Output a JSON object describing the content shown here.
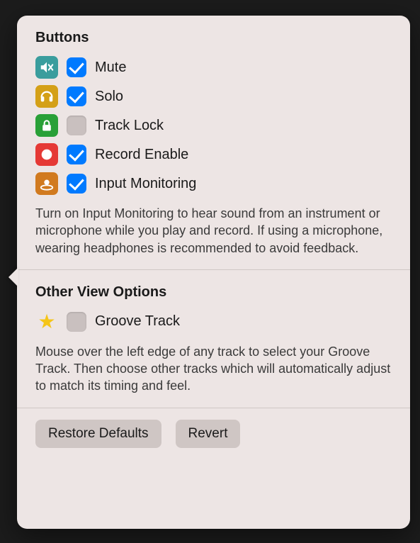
{
  "sections": {
    "buttons": {
      "title": "Buttons",
      "items": [
        {
          "label": "Mute",
          "checked": true
        },
        {
          "label": "Solo",
          "checked": true
        },
        {
          "label": "Track Lock",
          "checked": false
        },
        {
          "label": "Record Enable",
          "checked": true
        },
        {
          "label": "Input Monitoring",
          "checked": true
        }
      ],
      "description": "Turn on Input Monitoring to hear sound from an instrument or microphone while you play and record. If using a microphone, wearing headphones is recommended to avoid feedback."
    },
    "other": {
      "title": "Other View Options",
      "items": [
        {
          "label": "Groove Track",
          "checked": false
        }
      ],
      "description": "Mouse over the left edge of any track to select your Groove Track. Then choose other tracks which will automatically adjust to match its timing and feel."
    }
  },
  "footer": {
    "restore_label": "Restore Defaults",
    "revert_label": "Revert"
  }
}
